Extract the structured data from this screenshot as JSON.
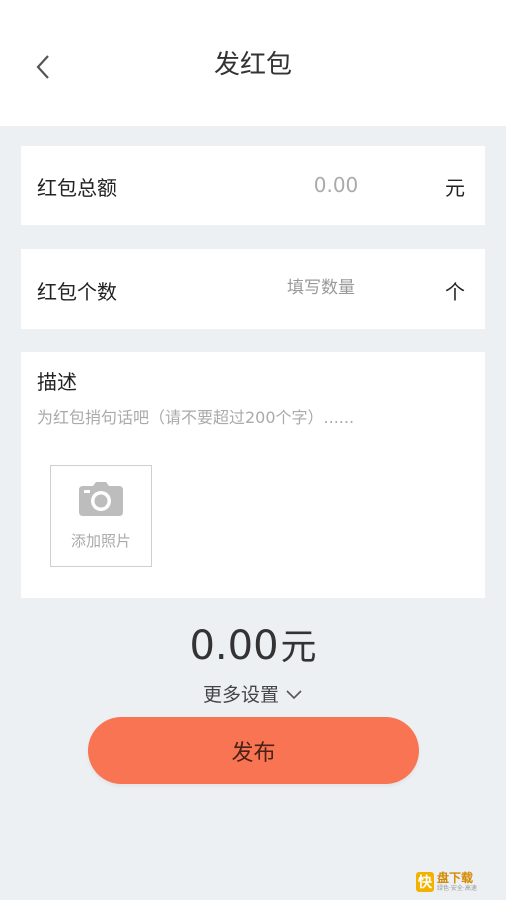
{
  "header": {
    "title": "发红包"
  },
  "amount_row": {
    "label": "红包总额",
    "placeholder": "0.00",
    "unit": "元"
  },
  "count_row": {
    "label": "红包个数",
    "placeholder": "填写数量",
    "unit": "个"
  },
  "description": {
    "label": "描述",
    "placeholder": "为红包捎句话吧（请不要超过200个字）......",
    "add_photo_label": "添加照片"
  },
  "total": {
    "value": "0.00",
    "unit": "元"
  },
  "more_settings": {
    "label": "更多设置"
  },
  "publish": {
    "label": "发布"
  },
  "watermark": {
    "name": "快",
    "brand": "盘下载",
    "tagline": "绿色·安全·高速"
  },
  "colors": {
    "accent": "#f97452",
    "background": "#edf0f3"
  }
}
